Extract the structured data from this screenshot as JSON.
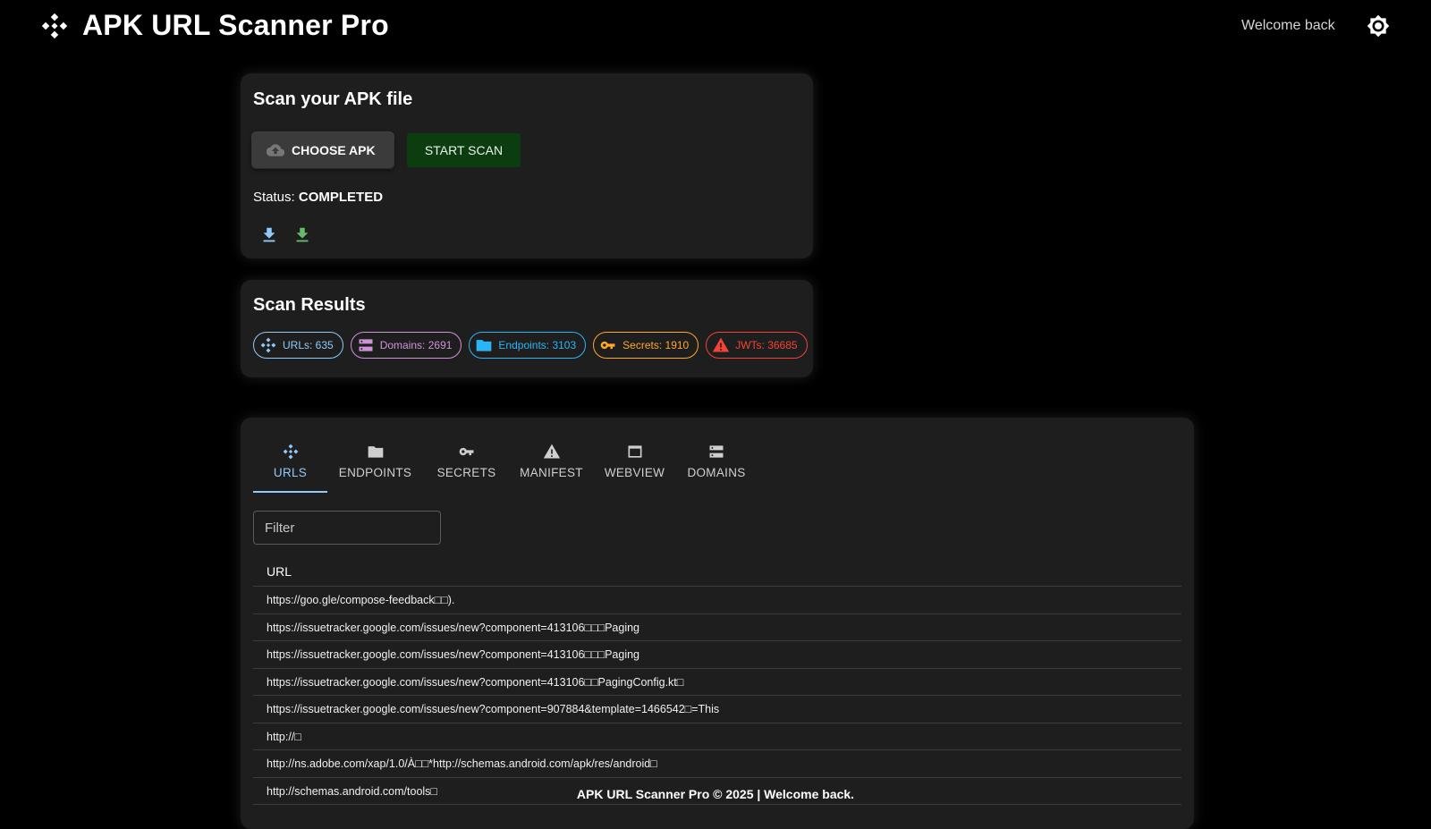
{
  "header": {
    "title": "APK URL Scanner Pro",
    "welcome": "Welcome back",
    "logo_icon": "hub-icon",
    "theme_icon": "brightness-icon"
  },
  "upload": {
    "heading": "Scan your APK file",
    "choose_label": "CHOOSE APK",
    "start_label": "START SCAN",
    "status_label": "Status:",
    "status_value": "COMPLETED",
    "download_icons": [
      "download-icon-blue",
      "download-icon-green"
    ]
  },
  "results": {
    "heading": "Scan Results",
    "chips": [
      {
        "label": "URLs: 635",
        "icon": "hub-icon",
        "color": "#90caf9"
      },
      {
        "label": "Domains: 2691",
        "icon": "storage-icon",
        "color": "#ce93d8"
      },
      {
        "label": "Endpoints: 3103",
        "icon": "folder-icon",
        "color": "#29b6f6"
      },
      {
        "label": "Secrets: 1910",
        "icon": "key-icon",
        "color": "#ffa726"
      },
      {
        "label": "JWTs: 36685",
        "icon": "warning-icon",
        "color": "#f44336"
      }
    ]
  },
  "tabs": [
    {
      "label": "URLS",
      "icon": "hub-icon",
      "active": true
    },
    {
      "label": "ENDPOINTS",
      "icon": "folder-icon",
      "active": false
    },
    {
      "label": "SECRETS",
      "icon": "key-icon",
      "active": false
    },
    {
      "label": "MANIFEST",
      "icon": "warning-icon",
      "active": false
    },
    {
      "label": "WEBVIEW",
      "icon": "window-icon",
      "active": false
    },
    {
      "label": "DOMAINS",
      "icon": "storage-icon",
      "active": false
    }
  ],
  "filter": {
    "placeholder": "Filter",
    "value": ""
  },
  "table": {
    "header": "URL",
    "rows": [
      "https://goo.gle/compose-feedback□□).",
      "https://issuetracker.google.com/issues/new?component=413106□□□Paging",
      "https://issuetracker.google.com/issues/new?component=413106□□□Paging",
      "https://issuetracker.google.com/issues/new?component=413106□□PagingConfig.kt□",
      "https://issuetracker.google.com/issues/new?component=907884&template=1466542□=This",
      "http://□",
      "http://ns.adobe.com/xap/1.0/À□□*http://schemas.android.com/apk/res/android□",
      "http://schemas.android.com/tools□"
    ]
  },
  "footer": "APK URL Scanner Pro © 2025 | Welcome back.",
  "colors": {
    "accent": "#90caf9",
    "start_bg": "#0b3d10",
    "card_bg": "#1e1e1e"
  }
}
